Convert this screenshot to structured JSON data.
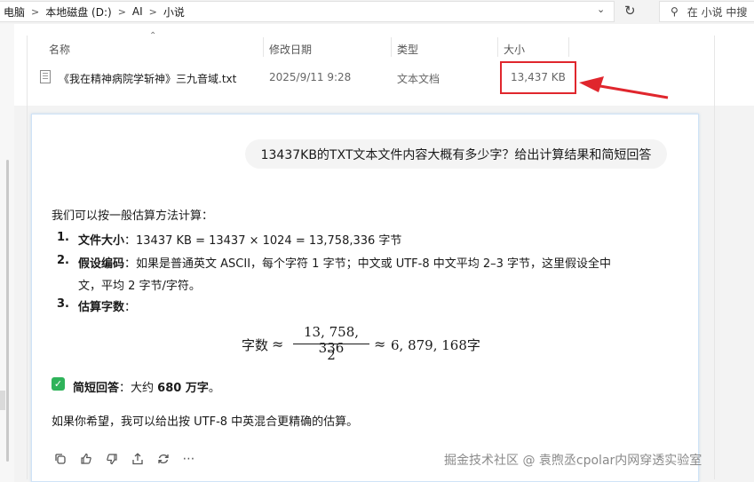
{
  "address": {
    "crumbs": [
      "电脑",
      "本地磁盘 (D:)",
      "AI",
      "小说"
    ],
    "separator": ">",
    "search_placeholder": "在 小说 中搜"
  },
  "icons": {
    "chevron": "chevron-down-icon",
    "refresh": "refresh-icon",
    "search": "search-icon",
    "file": "text-file-icon"
  },
  "filelist": {
    "headers": {
      "name": "名称",
      "date": "修改日期",
      "type": "类型",
      "size": "大小"
    },
    "file": {
      "name": "《我在精神病院学斩神》三九音域.txt",
      "date": "2025/9/11 9:28",
      "type": "文本文档",
      "size": "13,437 KB"
    }
  },
  "annotation": {
    "color": "#e0262d"
  },
  "chat": {
    "question": "13437KB的TXT文本文件内容大概有多少字？给出计算结果和简短回答",
    "intro": "我们可以按一般估算方法计算：",
    "items": [
      {
        "num": "1.",
        "title": "文件大小",
        "text": "：13437 KB = 13437 × 1024 = 13,758,336 字节"
      },
      {
        "num": "2.",
        "title": "假设编码",
        "text": "：如果是普通英文 ASCII，每个字符 1 字节；中文或 UTF-8 中文平均 2–3 字节，这里假设全中",
        "text2": "文，平均 2 字节/字符。"
      },
      {
        "num": "3.",
        "title": "估算字数",
        "text": "："
      }
    ],
    "formula": {
      "label": "字数",
      "approx": "≈",
      "numerator": "13, 758, 336",
      "denominator": "2",
      "result": "6, 879, 168",
      "unit": "字"
    },
    "short_answer": {
      "label": "简短回答",
      "prefix": "：大约 ",
      "value": "680 万字",
      "suffix": "。"
    },
    "followup": "如果你希望，我可以给出按 UTF-8 中英混合更精确的估算。",
    "actions": [
      "copy-icon",
      "thumbs-up-icon",
      "thumbs-down-icon",
      "share-icon",
      "regenerate-icon",
      "more-icon"
    ]
  },
  "watermark": "掘金技术社区 @ 袁煦丞cpolar内网穿透实验室"
}
